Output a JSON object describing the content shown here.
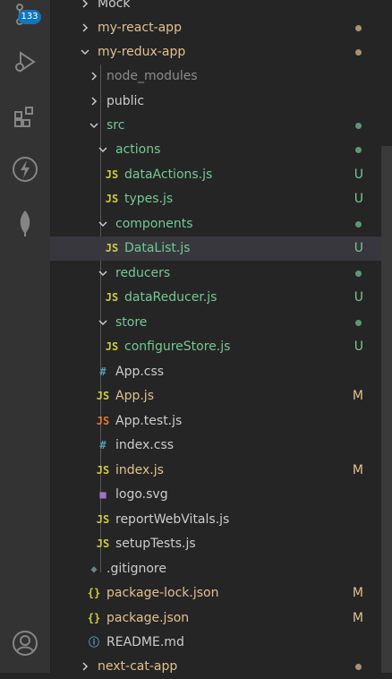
{
  "activity_bar": {
    "badge_count": "133",
    "icons": [
      "source-control-icon",
      "run-debug-icon",
      "extensions-icon",
      "thunder-client-icon",
      "mongodb-leaf-icon",
      "account-icon"
    ]
  },
  "colors": {
    "untracked": "#73c991",
    "modified": "#e2c08d",
    "default_text": "#cccccc",
    "ignored_text": "#8c8c8c",
    "js_icon": "#cbcb41",
    "css_icon": "#519aba",
    "test_icon": "#e37933",
    "svg_icon": "#a074c4"
  },
  "tree": [
    {
      "name": "Mock",
      "kind": "folder",
      "open": false,
      "status": ""
    },
    {
      "name": "my-react-app",
      "kind": "folder",
      "open": false,
      "status": "dot-modified"
    },
    {
      "name": "my-redux-app",
      "kind": "folder",
      "open": true,
      "status": "dot-modified"
    },
    {
      "name": "node_modules",
      "kind": "folder",
      "open": false,
      "status": ""
    },
    {
      "name": "public",
      "kind": "folder",
      "open": false,
      "status": ""
    },
    {
      "name": "src",
      "kind": "folder",
      "open": true,
      "status": "dot-untracked"
    },
    {
      "name": "actions",
      "kind": "folder",
      "open": true,
      "status": "dot-untracked"
    },
    {
      "name": "dataActions.js",
      "kind": "js",
      "status": "U"
    },
    {
      "name": "types.js",
      "kind": "js",
      "status": "U"
    },
    {
      "name": "components",
      "kind": "folder",
      "open": true,
      "status": "dot-untracked"
    },
    {
      "name": "DataList.js",
      "kind": "js",
      "status": "U",
      "selected": true
    },
    {
      "name": "reducers",
      "kind": "folder",
      "open": true,
      "status": "dot-untracked"
    },
    {
      "name": "dataReducer.js",
      "kind": "js",
      "status": "U"
    },
    {
      "name": "store",
      "kind": "folder",
      "open": true,
      "status": "dot-untracked"
    },
    {
      "name": "configureStore.js",
      "kind": "js",
      "status": "U"
    },
    {
      "name": "App.css",
      "kind": "css",
      "status": ""
    },
    {
      "name": "App.js",
      "kind": "js",
      "status": "M"
    },
    {
      "name": "App.test.js",
      "kind": "test",
      "status": ""
    },
    {
      "name": "index.css",
      "kind": "css",
      "status": ""
    },
    {
      "name": "index.js",
      "kind": "js",
      "status": "M"
    },
    {
      "name": "logo.svg",
      "kind": "svg",
      "status": ""
    },
    {
      "name": "reportWebVitals.js",
      "kind": "js",
      "status": ""
    },
    {
      "name": "setupTests.js",
      "kind": "js",
      "status": ""
    },
    {
      "name": ".gitignore",
      "kind": "git",
      "status": ""
    },
    {
      "name": "package-lock.json",
      "kind": "json",
      "status": "M"
    },
    {
      "name": "package.json",
      "kind": "json",
      "status": "M"
    },
    {
      "name": "README.md",
      "kind": "info",
      "status": ""
    },
    {
      "name": "next-cat-app",
      "kind": "folder",
      "open": false,
      "status": "dot-modified"
    }
  ]
}
